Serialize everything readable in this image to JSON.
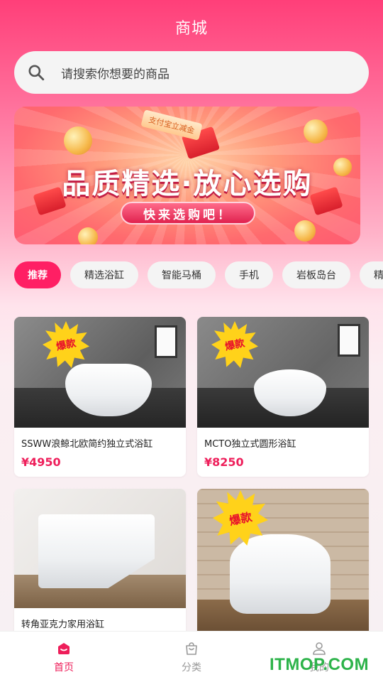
{
  "page": {
    "title": "商城"
  },
  "search": {
    "placeholder": "请搜索你想要的商品"
  },
  "banner": {
    "headline": "品质精选·放心选购",
    "button": "快来选购吧！",
    "ticket_text": "支付宝立减金"
  },
  "categories": [
    {
      "label": "推荐",
      "active": true
    },
    {
      "label": "精选浴缸",
      "active": false
    },
    {
      "label": "智能马桶",
      "active": false
    },
    {
      "label": "手机",
      "active": false
    },
    {
      "label": "岩板岛台",
      "active": false
    },
    {
      "label": "精品手",
      "active": false
    }
  ],
  "products": [
    {
      "name": "SSWW浪鲸北欧简约独立式浴缸",
      "price": "¥4950",
      "badge": "爆款"
    },
    {
      "name": "MCTO独立式圆形浴缸",
      "price": "¥8250",
      "badge": "爆款"
    },
    {
      "name": "转角亚克力家用浴缸",
      "price": "",
      "badge": ""
    },
    {
      "name": "",
      "price": "",
      "badge": "爆款"
    }
  ],
  "tabbar": [
    {
      "label": "首页",
      "icon": "home-bag-icon",
      "active": true
    },
    {
      "label": "分类",
      "icon": "bag-icon",
      "active": false
    },
    {
      "label": "我的",
      "icon": "user-icon",
      "active": false
    }
  ],
  "watermark": "ITMOP.COM",
  "colors": {
    "accent": "#ff1f64",
    "price": "#ee1e5a",
    "watermark": "#2db34a"
  }
}
